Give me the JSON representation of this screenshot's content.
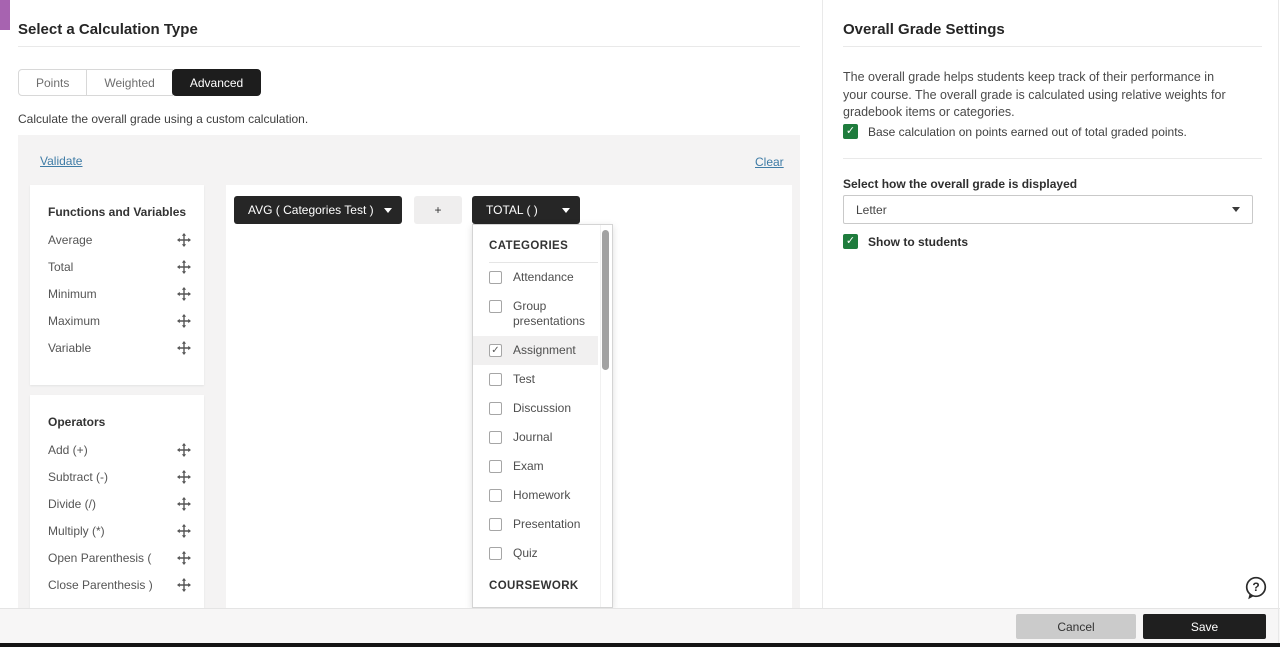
{
  "icons": {
    "checkmark": "✓",
    "plus_chip": "+",
    "question_mark": "?"
  },
  "colors": {
    "accent_purple": "#a763b0",
    "checkbox_green": "#1f7c3d",
    "chip_dark": "#262626",
    "link_blue": "#3f7ca6"
  },
  "left": {
    "title": "Select a Calculation Type",
    "tabs": [
      {
        "label": "Points",
        "active": false
      },
      {
        "label": "Weighted",
        "active": false
      },
      {
        "label": "Advanced",
        "active": true
      }
    ],
    "description": "Calculate the overall grade using a custom calculation.",
    "validate_label": "Validate",
    "clear_label": "Clear",
    "functions_panel": {
      "title": "Functions and Variables",
      "items": [
        "Average",
        "Total",
        "Minimum",
        "Maximum",
        "Variable"
      ]
    },
    "operators_panel": {
      "title": "Operators",
      "items": [
        "Add (+)",
        "Subtract (-)",
        "Divide (/)",
        "Multiply (*)",
        "Open Parenthesis (",
        "Close Parenthesis )"
      ]
    },
    "expression": {
      "chips": [
        {
          "label": "AVG ( Categories Test )",
          "kind": "function"
        },
        {
          "label": "+",
          "kind": "operator"
        },
        {
          "label": "TOTAL ( )",
          "kind": "function",
          "menu_open": true
        }
      ]
    },
    "category_menu": {
      "sections": [
        {
          "header": "CATEGORIES",
          "items": [
            {
              "label": "Attendance",
              "checked": false
            },
            {
              "label": "Group presentations",
              "checked": false
            },
            {
              "label": "Assignment",
              "checked": true
            },
            {
              "label": "Test",
              "checked": false
            },
            {
              "label": "Discussion",
              "checked": false
            },
            {
              "label": "Journal",
              "checked": false
            },
            {
              "label": "Exam",
              "checked": false
            },
            {
              "label": "Homework",
              "checked": false
            },
            {
              "label": "Presentation",
              "checked": false
            },
            {
              "label": "Quiz",
              "checked": false
            }
          ]
        },
        {
          "header": "COURSEWORK",
          "items": []
        }
      ]
    }
  },
  "right": {
    "title": "Overall Grade Settings",
    "description": "The overall grade helps students keep track of their performance in your course. The overall grade is calculated using relative weights for gradebook items or categories.",
    "base_calculation_checkbox": {
      "label": "Base calculation on points earned out of total graded points.",
      "checked": true
    },
    "display_section": {
      "label": "Select how the overall grade is displayed",
      "selected_value": "Letter"
    },
    "show_to_students_checkbox": {
      "label": "Show to students",
      "checked": true
    }
  },
  "footer": {
    "cancel_label": "Cancel",
    "save_label": "Save"
  }
}
